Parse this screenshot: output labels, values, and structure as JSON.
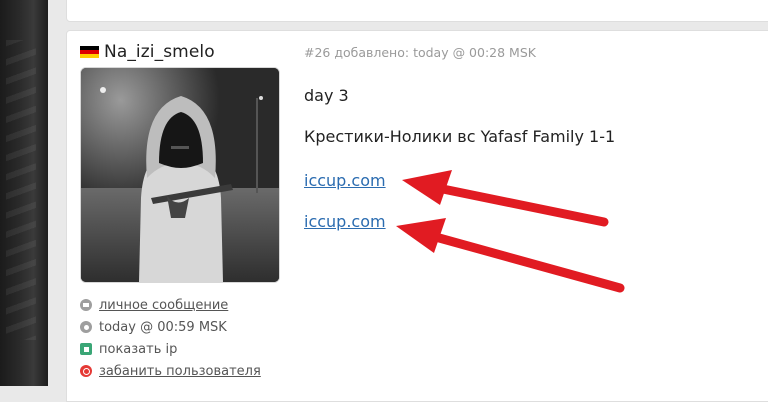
{
  "post": {
    "author": {
      "name": "Na_izi_smelo",
      "flag_icon": "germany-flag-icon",
      "avatar_icon": "hooded-figure-avatar"
    },
    "meta": "#26 добавлено: today @ 00:28 MSK",
    "lines": {
      "day": "day 3",
      "match": "Крестики-Нолики вс Yafasf Family 1-1",
      "link1": "iccup.com",
      "link2": "iccup.com"
    },
    "actions": {
      "message": "личное сообщение",
      "last_seen": "today @ 00:59 MSK",
      "show_ip": "показать ip",
      "ban": "забанить пользователя"
    }
  },
  "colors": {
    "link": "#2b6cb0",
    "arrow": "#e11b22",
    "meta_text": "#9a9a9a"
  }
}
